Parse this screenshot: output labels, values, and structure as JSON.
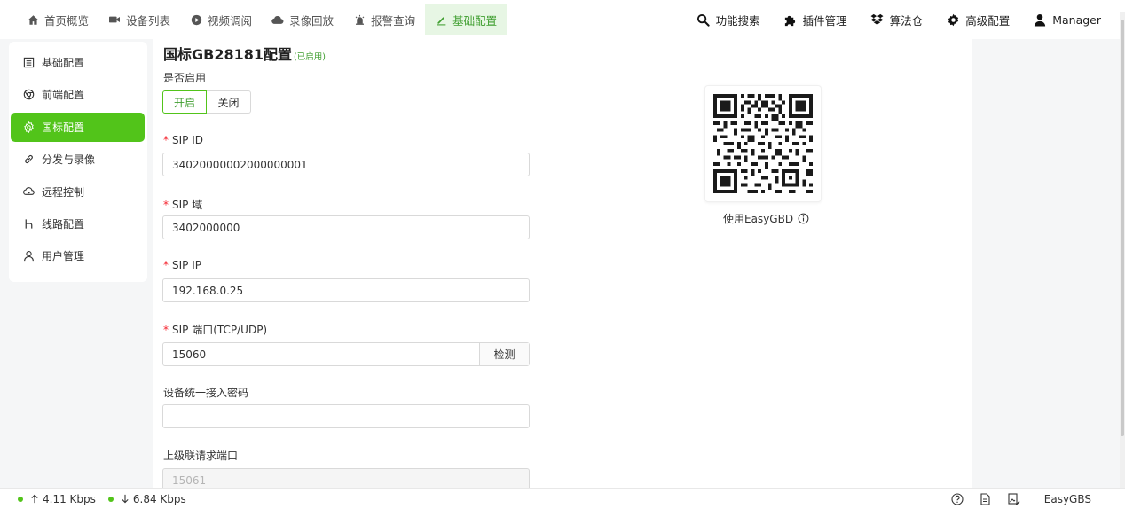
{
  "nav": {
    "left": [
      {
        "label": "首页概览",
        "icon": "home-icon"
      },
      {
        "label": "设备列表",
        "icon": "video-camera-icon"
      },
      {
        "label": "视频调阅",
        "icon": "play-circle-icon"
      },
      {
        "label": "录像回放",
        "icon": "cloud-icon"
      },
      {
        "label": "报警查询",
        "icon": "alarm-icon"
      },
      {
        "label": "基础配置",
        "icon": "edit-icon",
        "active": true
      }
    ],
    "right": [
      {
        "label": "功能搜索",
        "icon": "search-icon"
      },
      {
        "label": "插件管理",
        "icon": "puzzle-icon"
      },
      {
        "label": "算法仓",
        "icon": "dropbox-icon"
      },
      {
        "label": "高级配置",
        "icon": "gear-icon"
      },
      {
        "label": "Manager",
        "icon": "user-icon"
      }
    ]
  },
  "sidebar": {
    "items": [
      {
        "label": "基础配置",
        "icon": "list-icon"
      },
      {
        "label": "前端配置",
        "icon": "chrome-icon"
      },
      {
        "label": "国标配置",
        "icon": "gear-icon",
        "active": true
      },
      {
        "label": "分发与录像",
        "icon": "link-icon"
      },
      {
        "label": "远程控制",
        "icon": "cloud-icon"
      },
      {
        "label": "线路配置",
        "icon": "route-icon"
      },
      {
        "label": "用户管理",
        "icon": "user-icon"
      }
    ]
  },
  "form": {
    "title": "国标GB28181配置",
    "title_tag": "(已启用)",
    "enable_label": "是否启用",
    "enable_on": "开启",
    "enable_off": "关闭",
    "sip_id_label": "SIP ID",
    "sip_id_value": "34020000002000000001",
    "sip_domain_label": "SIP 域",
    "sip_domain_value": "3402000000",
    "sip_ip_label": "SIP IP",
    "sip_ip_value": "192.168.0.25",
    "sip_port_label": "SIP 端口(TCP/UDP)",
    "sip_port_value": "15060",
    "sip_port_check": "检测",
    "password_label": "设备统一接入密码",
    "password_value": "",
    "cascade_port_label": "上级联请求端口",
    "cascade_port_value": "15061"
  },
  "qr": {
    "caption": "使用EasyGBD"
  },
  "status": {
    "up": "4.11 Kbps",
    "down": "6.84 Kbps",
    "brand": "EasyGBS"
  },
  "colors": {
    "accent": "#52c41a",
    "accent_text": "#3f9e2f",
    "required": "#f5222d"
  }
}
